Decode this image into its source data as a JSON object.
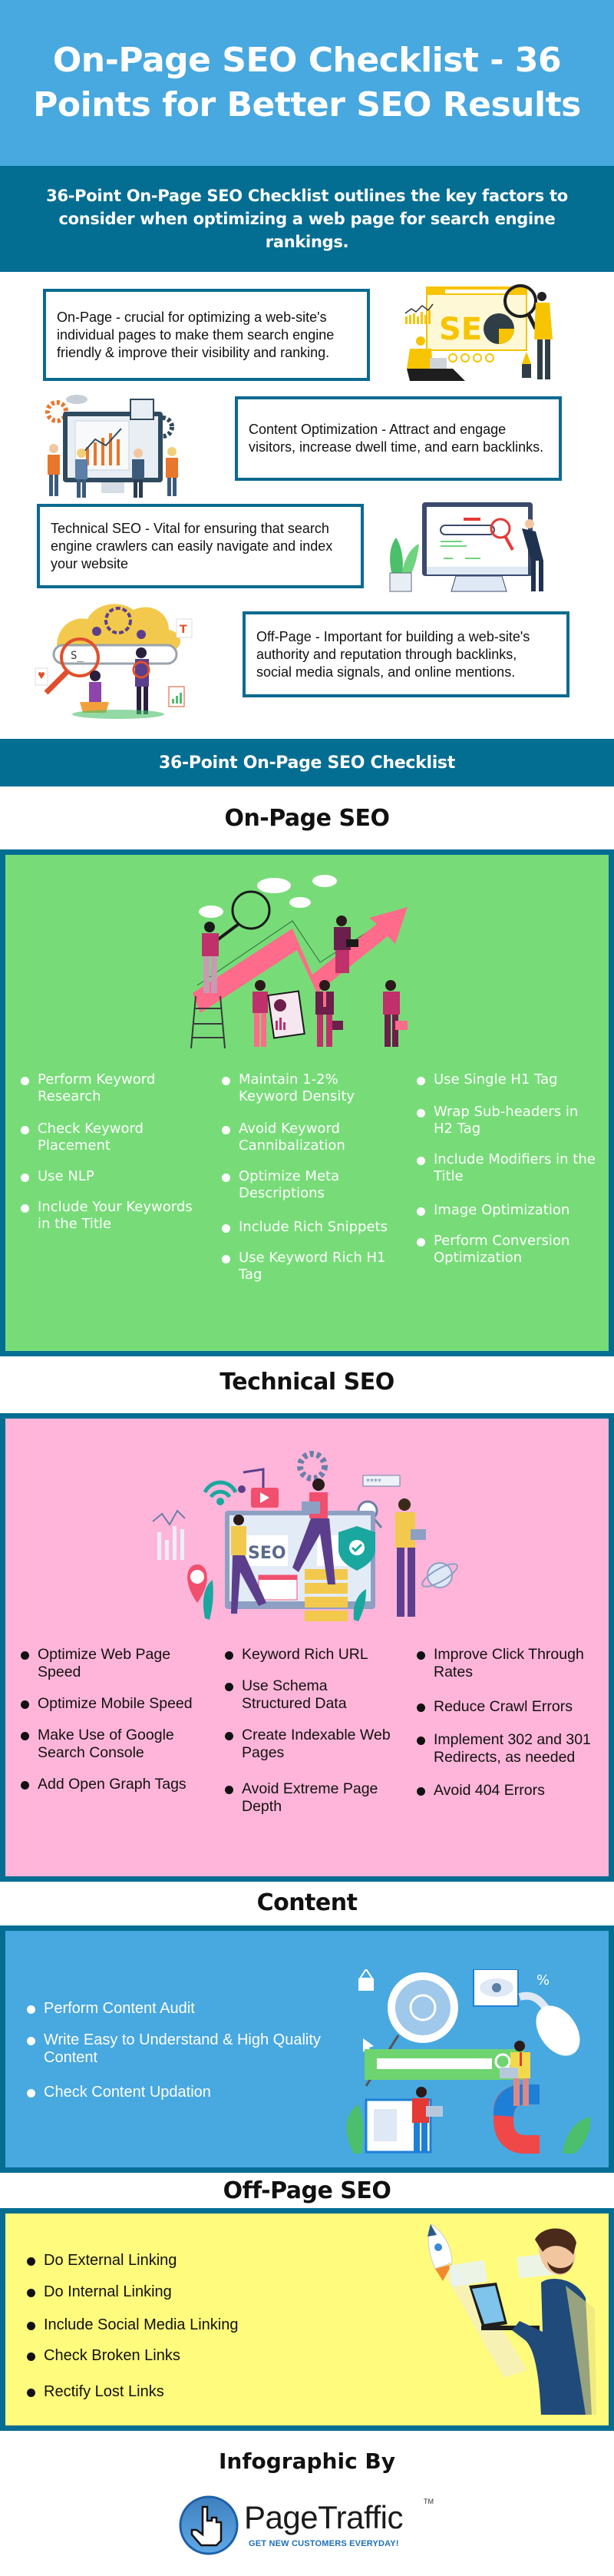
{
  "header": {
    "title": "On-Page SEO Checklist - 36 Points for Better SEO Results",
    "intro": "36-Point On-Page SEO Checklist outlines the key factors to consider when optimizing a web page for search engine rankings."
  },
  "definitions": [
    {
      "text": "On-Page  - crucial for optimizing a web-site's individual pages to make them search engine friendly & improve their visibility and ranking.",
      "illustration": "seo-analysis-illustration"
    },
    {
      "text": "Content Optimization - Attract and engage visitors, increase dwell time, and earn backlinks.",
      "illustration": "team-dashboard-illustration"
    },
    {
      "text": "Technical SEO - Vital for ensuring that search engine crawlers can easily navigate and index your website",
      "illustration": "monitor-search-illustration"
    },
    {
      "text": "Off-Page - Important for building a web-site's authority and reputation through backlinks, social media signals, and online mentions.",
      "illustration": "search-cloud-illustration"
    }
  ],
  "checklist_banner": "36-Point On-Page SEO Checklist",
  "sections": {
    "onpage": {
      "heading": "On-Page SEO",
      "bg_color": "#77dc78",
      "columns": [
        [
          "Perform Keyword Research",
          "Check Keyword Placement",
          "Use NLP",
          "Include Your Keywords in the Title"
        ],
        [
          "Maintain 1-2% Keyword Density",
          "Avoid Keyword Cannibalization",
          "Optimize Meta Descriptions",
          "Include Rich Snippets",
          "Use Keyword Rich H1 Tag"
        ],
        [
          "Use Single H1 Tag",
          "Wrap Sub-headers in H2 Tag",
          "Include Modifiers in the Title",
          "Image Optimization",
          "Perform Conversion Optimization"
        ]
      ]
    },
    "technical": {
      "heading": "Technical SEO",
      "bg_color": "#ffb5d9",
      "columns": [
        [
          "Optimize Web Page Speed",
          "Optimize Mobile Speed",
          "Make Use of Google Search Console",
          "Add Open Graph Tags"
        ],
        [
          "Keyword Rich URL",
          "Use Schema Structured Data",
          "Create Indexable Web Pages",
          "Avoid Extreme Page Depth"
        ],
        [
          "Improve Click Through Rates",
          "Reduce Crawl Errors",
          "Implement 302 and 301 Redirects, as needed",
          "Avoid 404 Errors"
        ]
      ]
    },
    "content": {
      "heading": "Content",
      "bg_color": "#48a8e0",
      "items": [
        "Perform Content Audit",
        "Write Easy to Understand & High Quality Content",
        "Check Content Updation"
      ]
    },
    "offpage": {
      "heading": "Off-Page SEO",
      "bg_color": "#fffb7c",
      "items": [
        "Do External Linking",
        "Do Internal Linking",
        "Include Social Media Linking",
        "Check Broken Links",
        "Rectify Lost Links"
      ]
    }
  },
  "footer": {
    "credit": "Infographic By",
    "brand": "PageTraffic",
    "tm": "TM",
    "tagline": "GET NEW CUSTOMERS EVERYDAY!"
  },
  "colors": {
    "title_band": "#48a8e0",
    "dark_band": "#046d92",
    "border": "#0b6a8f"
  }
}
